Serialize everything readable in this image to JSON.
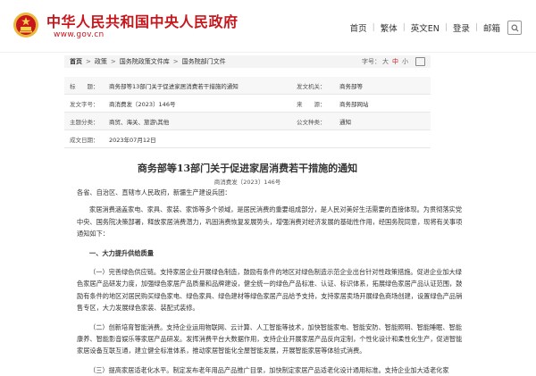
{
  "site": {
    "title": "中华人民共和国中央人民政府",
    "url": "www.gov.cn"
  },
  "topnav": {
    "items": [
      "首页",
      "繁体",
      "英文EN",
      "登录",
      "邮箱"
    ],
    "search_icon": "search-icon"
  },
  "breadcrumb": {
    "items": [
      "首页",
      "政策",
      "国务院政策文件库",
      "国务院部门文件"
    ],
    "fontsize_label": "字号：",
    "sizes": [
      "大",
      "中",
      "小"
    ],
    "print_icon": "printer-icon"
  },
  "info": {
    "rows": [
      {
        "k1": "标　　题：",
        "v1": "商务部等13部门关于促进家居消费若干措施的通知",
        "k2": "发文机关：",
        "v2": "商务部等"
      },
      {
        "k1": "发文字号：",
        "v1": "商消费发〔2023〕146号",
        "k2": "来　　源：",
        "v2": "商务部网站"
      },
      {
        "k1": "主题分类：",
        "v1": "商贸、海关、旅游\\其他",
        "k2": "公文种类：",
        "v2": "通知"
      },
      {
        "k1": "成文日期：",
        "v1": "2023年07月12日",
        "k2": "",
        "v2": ""
      }
    ]
  },
  "document": {
    "title": "商务部等13部门关于促进家居消费若干措施的通知",
    "number": "商消费发〔2023〕146号",
    "salutation": "各省、自治区、直辖市人民政府，新疆生产建设兵团：",
    "intro": "家居消费涵盖家电、家具、家装、家饰等多个领域，是居民消费的重要组成部分，是人民对美好生活需要的直接体现。为贯彻落实党中央、国务院决策部署，释放家居消费潜力，巩固消费恢复发展势头，增强消费对经济发展的基础性作用，经国务院同意，现将有关事项通知如下：",
    "section1": "一、大力提升供给质量",
    "p1": "（一）完善绿色供应链。支持家居企业开展绿色制造，鼓励有条件的地区对绿色制造示范企业出台针对性政策措施。促进企业加大绿色家居产品研发力度，加强绿色家居产品质量和品牌建设，健全统一的绿色产品标准、认证、标识体系，拓展绿色家居产品认证范围，鼓励有条件的地区对居民购买绿色家电、绿色家具、绿色建材等绿色家居产品给予支持，支持家居卖场开展绿色商场创建，设置绿色产品销售专区，大力发展绿色家装、装配式装修。",
    "p2": "（二）创新培育智能消费。支持企业运用物联网、云计算、人工智能等技术，加快智能家电、智能安防、智能照明、智能睡眠、智能康养、智能影音娱乐等家居产品研发。发挥消费平台大数据作用，支持企业开展家居产品反向定制，个性化设计和柔性化生产，促进智能家居设备互联互通，建立健全标准体系，推动家居智能化全屋智能发展，开展智能家居等体验式消费。",
    "p3": "（三）提高家居适老化水平。制定发布老年用品产品推广目录，加快制定家居产品适老化设计通用标准。支持企业加大适老化家"
  }
}
